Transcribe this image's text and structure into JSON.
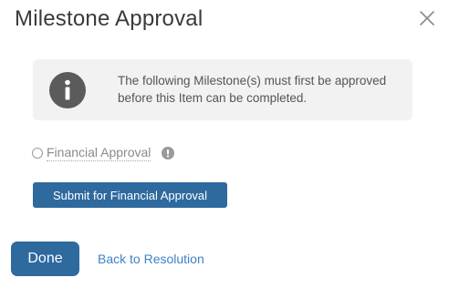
{
  "dialog": {
    "title": "Milestone Approval",
    "close_icon": "close-icon"
  },
  "notice": {
    "icon": "info-icon",
    "text": "The following Milestone(s) must first be approved before this Item can be completed."
  },
  "milestones": [
    {
      "label": "Financial Approval",
      "selected": false,
      "help_icon": "help-icon"
    }
  ],
  "actions": {
    "submit_label": "Submit for Financial Approval",
    "done_label": "Done",
    "back_label": "Back to Resolution"
  },
  "colors": {
    "primary_button": "#2e6a9e",
    "link": "#3f82c4",
    "notice_background": "#f2f2f2",
    "info_icon": "#5b5b5b"
  }
}
